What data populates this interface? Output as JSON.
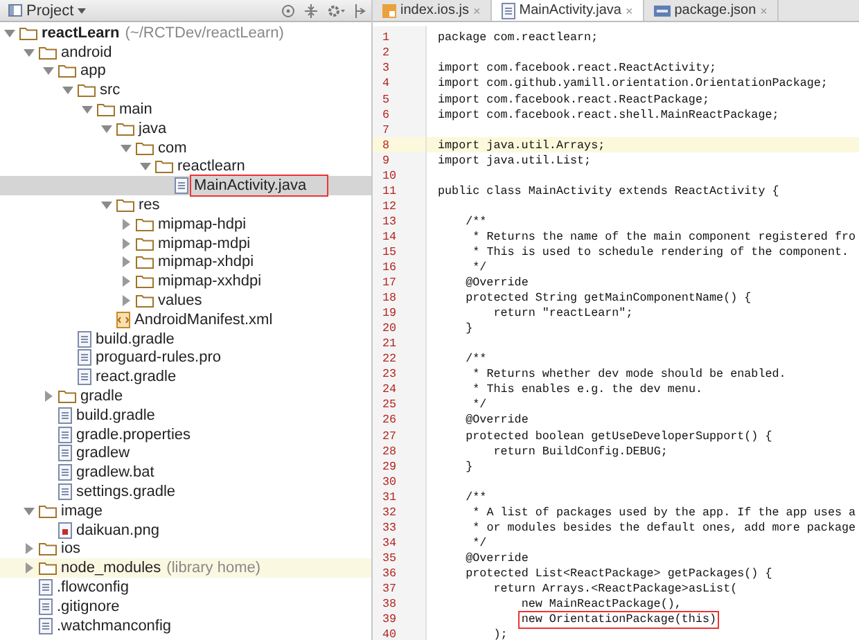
{
  "project_panel": {
    "title": "Project",
    "tree": [
      {
        "kind": "folder",
        "label": "reactLearn",
        "note": "(~/RCTDev/reactLearn)",
        "bold": true,
        "expanded": true,
        "children": [
          {
            "kind": "folder",
            "label": "android",
            "expanded": true,
            "children": [
              {
                "kind": "folder",
                "label": "app",
                "expanded": true,
                "children": [
                  {
                    "kind": "folder",
                    "label": "src",
                    "expanded": true,
                    "children": [
                      {
                        "kind": "folder",
                        "label": "main",
                        "expanded": true,
                        "children": [
                          {
                            "kind": "folder",
                            "label": "java",
                            "expanded": true,
                            "children": [
                              {
                                "kind": "folder",
                                "label": "com",
                                "expanded": true,
                                "children": [
                                  {
                                    "kind": "folder",
                                    "label": "reactlearn",
                                    "expanded": true,
                                    "children": [
                                      {
                                        "kind": "file",
                                        "label": "MainActivity.java",
                                        "selected": true,
                                        "boxed": true
                                      }
                                    ]
                                  }
                                ]
                              }
                            ]
                          },
                          {
                            "kind": "folder",
                            "label": "res",
                            "expanded": true,
                            "children": [
                              {
                                "kind": "folder",
                                "label": "mipmap-hdpi",
                                "expanded": false
                              },
                              {
                                "kind": "folder",
                                "label": "mipmap-mdpi",
                                "expanded": false
                              },
                              {
                                "kind": "folder",
                                "label": "mipmap-xhdpi",
                                "expanded": false
                              },
                              {
                                "kind": "folder",
                                "label": "mipmap-xxhdpi",
                                "expanded": false
                              },
                              {
                                "kind": "folder",
                                "label": "values",
                                "expanded": false
                              }
                            ]
                          },
                          {
                            "kind": "xml",
                            "label": "AndroidManifest.xml"
                          }
                        ]
                      }
                    ]
                  },
                  {
                    "kind": "file",
                    "label": "build.gradle"
                  },
                  {
                    "kind": "file",
                    "label": "proguard-rules.pro"
                  },
                  {
                    "kind": "file",
                    "label": "react.gradle"
                  }
                ]
              },
              {
                "kind": "folder",
                "label": "gradle",
                "expanded": false
              },
              {
                "kind": "file",
                "label": "build.gradle"
              },
              {
                "kind": "file",
                "label": "gradle.properties"
              },
              {
                "kind": "file",
                "label": "gradlew"
              },
              {
                "kind": "file",
                "label": "gradlew.bat"
              },
              {
                "kind": "file",
                "label": "settings.gradle"
              }
            ]
          },
          {
            "kind": "folder",
            "label": "image",
            "expanded": true,
            "children": [
              {
                "kind": "image",
                "label": "daikuan.png"
              }
            ]
          },
          {
            "kind": "folder",
            "label": "ios",
            "expanded": false
          },
          {
            "kind": "folder",
            "label": "node_modules",
            "note": "(library home)",
            "expanded": false,
            "highlighted": true
          },
          {
            "kind": "file",
            "label": ".flowconfig"
          },
          {
            "kind": "file",
            "label": ".gitignore"
          },
          {
            "kind": "file",
            "label": ".watchmanconfig"
          }
        ]
      }
    ]
  },
  "editor": {
    "tabs": [
      {
        "kind": "js",
        "label": "index.ios.js",
        "close": "×",
        "selected": false
      },
      {
        "kind": "java",
        "label": "MainActivity.java",
        "close": "×",
        "selected": true
      },
      {
        "kind": "json",
        "label": "package.json",
        "close": "×",
        "selected": false
      }
    ],
    "lines": [
      {
        "number": "1",
        "text": "package com.reactlearn;"
      },
      {
        "number": "2"
      },
      {
        "number": "3",
        "text": "import com.facebook.react.ReactActivity;"
      },
      {
        "number": "4",
        "text": "import com.github.yamill.orientation.OrientationPackage;"
      },
      {
        "number": "5",
        "text": "import com.facebook.react.ReactPackage;"
      },
      {
        "number": "6",
        "text": "import com.facebook.react.shell.MainReactPackage;"
      },
      {
        "number": "7"
      },
      {
        "number": "8",
        "text": "import java.util.Arrays;",
        "highlighted": true
      },
      {
        "number": "9",
        "text": "import java.util.List;"
      },
      {
        "number": "10"
      },
      {
        "number": "11",
        "text": "public class MainActivity extends ReactActivity {"
      },
      {
        "number": "12"
      },
      {
        "number": "13",
        "text": "    /**"
      },
      {
        "number": "14",
        "text": "     * Returns the name of the main component registered fro"
      },
      {
        "number": "15",
        "text": "     * This is used to schedule rendering of the component."
      },
      {
        "number": "16",
        "text": "     */"
      },
      {
        "number": "17",
        "text": "    @Override"
      },
      {
        "number": "18",
        "text": "    protected String getMainComponentName() {"
      },
      {
        "number": "19",
        "text": "        return \"reactLearn\";"
      },
      {
        "number": "20",
        "text": "    }"
      },
      {
        "number": "21"
      },
      {
        "number": "22",
        "text": "    /**"
      },
      {
        "number": "23",
        "text": "     * Returns whether dev mode should be enabled."
      },
      {
        "number": "24",
        "text": "     * This enables e.g. the dev menu."
      },
      {
        "number": "25",
        "text": "     */"
      },
      {
        "number": "26",
        "text": "    @Override"
      },
      {
        "number": "27",
        "text": "    protected boolean getUseDeveloperSupport() {"
      },
      {
        "number": "28",
        "text": "        return BuildConfig.DEBUG;"
      },
      {
        "number": "29",
        "text": "    }"
      },
      {
        "number": "30"
      },
      {
        "number": "31",
        "text": "    /**"
      },
      {
        "number": "32",
        "text": "     * A list of packages used by the app. If the app uses a"
      },
      {
        "number": "33",
        "text": "     * or modules besides the default ones, add more package"
      },
      {
        "number": "34",
        "text": "     */"
      },
      {
        "number": "35",
        "text": "    @Override"
      },
      {
        "number": "36",
        "text": "    protected List<ReactPackage> getPackages() {"
      },
      {
        "number": "37",
        "text": "        return Arrays.<ReactPackage>asList("
      },
      {
        "number": "38",
        "text": "            new MainReactPackage(),"
      },
      {
        "number": "39",
        "text": "            new OrientationPackage(this)",
        "boxed": true
      },
      {
        "number": "40",
        "text": "        );"
      }
    ]
  }
}
